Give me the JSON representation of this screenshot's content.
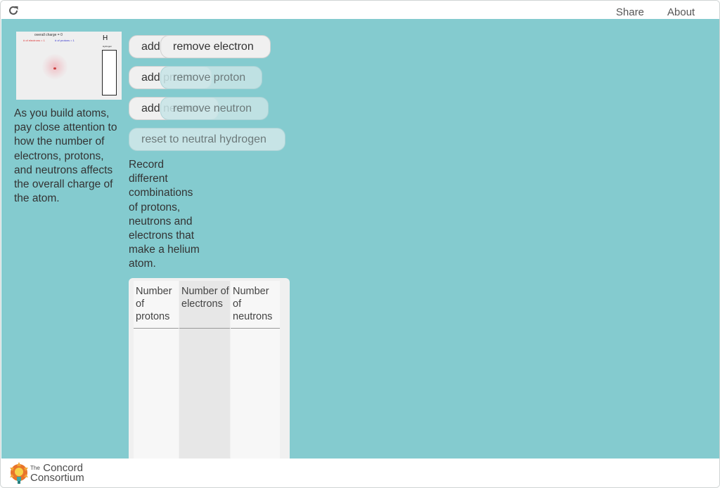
{
  "topbar": {
    "reload_icon": "reload-icon",
    "share_label": "Share",
    "about_label": "About"
  },
  "thumbnail": {
    "overall_charge": "overall charge = 0",
    "electrons_label": "# of electrons = 1",
    "protons_label": "# of protons = 1",
    "element_symbol": "H",
    "element_name": "Hydrogen"
  },
  "intro_text": "As you build atoms, pay close attention to how the number of electrons, protons, and neutrons affects the overall charge of the atom.",
  "buttons": {
    "add_electron": "add",
    "remove_electron": "remove electron",
    "add_proton": "add proton",
    "remove_proton": "remove proton",
    "add_neutron": "add neutron",
    "remove_neutron": "remove neutron",
    "reset": "reset to neutral hydrogen"
  },
  "record_text": "Record different combinations of protons, neutrons and electrons that make a helium atom.",
  "table": {
    "headers": [
      "Number of protons",
      "Number of electrons",
      "Number of neutrons"
    ]
  },
  "footer": {
    "logo_the": "The",
    "logo_line1": "Concord",
    "logo_line2": "Consortium"
  },
  "colors": {
    "background": "#84cbcf",
    "button_light": "#f0f0f0",
    "button_dim": "#c7e4e6"
  }
}
